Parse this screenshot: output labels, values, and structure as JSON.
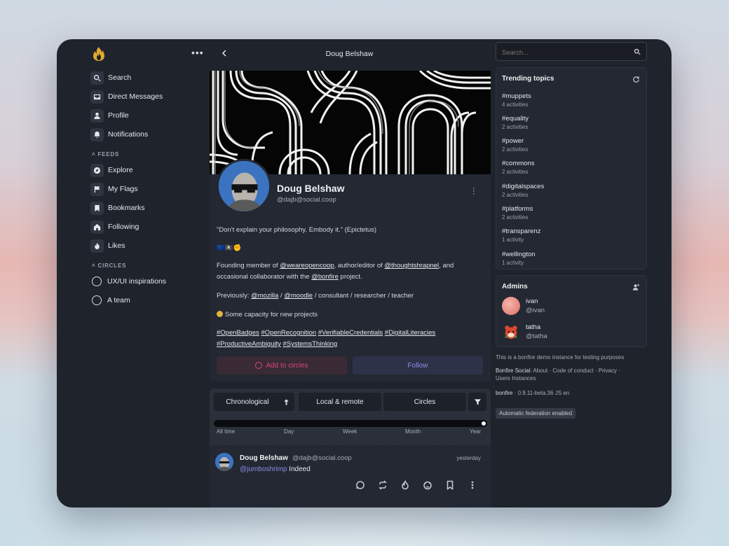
{
  "sidebar": {
    "items": [
      {
        "label": "Search",
        "icon": "search-icon"
      },
      {
        "label": "Direct Messages",
        "icon": "inbox-icon"
      },
      {
        "label": "Profile",
        "icon": "user-icon"
      },
      {
        "label": "Notifications",
        "icon": "bell-icon"
      }
    ],
    "feeds_label": "FEEDS",
    "feeds": [
      {
        "label": "Explore",
        "icon": "compass-icon"
      },
      {
        "label": "My Flags",
        "icon": "flag-icon"
      },
      {
        "label": "Bookmarks",
        "icon": "bookmark-icon"
      },
      {
        "label": "Following",
        "icon": "home-icon"
      },
      {
        "label": "Likes",
        "icon": "flame-icon"
      }
    ],
    "circles_label": "CIRCLES",
    "circles": [
      {
        "label": "UX/UI inspirations"
      },
      {
        "label": "A team"
      }
    ]
  },
  "header": {
    "title": "Doug Belshaw"
  },
  "profile": {
    "name": "Doug Belshaw",
    "handle": "@dajb@social.coop",
    "quote": "\"Don't explain your philosophy. Embody it.\" (Epictetus)",
    "emojis": "🇪🇺🏴‍☠️✊",
    "bio_line1_a": "Founding member of ",
    "bio_link1": "@weareopencoop",
    "bio_line1_b": ", author/editor of ",
    "bio_link2": "@thoughtshrapnel",
    "bio_line1_c": ", and",
    "bio_line2_a": "occasional collaborator with the ",
    "bio_link3": "@bonfire",
    "bio_line2_b": " project.",
    "prev_label": "Previously: ",
    "prev_link1": "@mozilla",
    "prev_sep": " / ",
    "prev_link2": "@moodle",
    "prev_rest": " / consultant / researcher / teacher",
    "capacity": "Some capacity for new projects",
    "tags_line1": [
      "#OpenBadges",
      "#OpenRecognition",
      "#VerifiableCredentials",
      "#DigitalLiteracies"
    ],
    "tags_line2": [
      "#ProductiveAmbiguity",
      "#SystemsThinking"
    ],
    "add_to_circles": "Add to circles",
    "follow": "Follow"
  },
  "feed_controls": {
    "sort": "Chronological",
    "scope": "Local & remote",
    "circles": "Circles",
    "time_labels": [
      "All time",
      "Day",
      "Week",
      "Month",
      "Year"
    ],
    "time_value": "Year"
  },
  "post": {
    "author": "Doug Belshaw",
    "handle": "@dajb@social.coop",
    "time": "yesterday",
    "mention": "@jumboshrimp",
    "text": " Indeed"
  },
  "search": {
    "placeholder": "Search..."
  },
  "trending": {
    "title": "Trending topics",
    "topics": [
      {
        "tag": "#muppets",
        "count": "4 activities"
      },
      {
        "tag": "#equality",
        "count": "2 activities"
      },
      {
        "tag": "#power",
        "count": "2 activities"
      },
      {
        "tag": "#commons",
        "count": "2 activities"
      },
      {
        "tag": "#digitalspaces",
        "count": "2 activities"
      },
      {
        "tag": "#platforms",
        "count": "2 activities"
      },
      {
        "tag": "#transparenz",
        "count": "1 activity"
      },
      {
        "tag": "#wellington",
        "count": "1 activity"
      }
    ]
  },
  "admins": {
    "title": "Admins",
    "list": [
      {
        "name": "ivan",
        "handle": "@ivan",
        "color": "#e98a84"
      },
      {
        "name": "tatha",
        "handle": "@tatha",
        "color": "#d94a2e"
      }
    ]
  },
  "footer": {
    "description": "This is a bonfire demo instance for testing purposes",
    "brand": "Bonfire Social",
    "links_line1": ": About · Code of conduct · Privacy ·",
    "links_line2": "Users Instances",
    "version_brand": "bonfire",
    "version": " · 0.9.11-beta.36  JS  en",
    "federation": "Automatic federation enabled"
  },
  "colors": {
    "window_bg": "#1f232b",
    "accent_pink": "#d6477f",
    "accent_indigo": "#8a8fe8"
  }
}
